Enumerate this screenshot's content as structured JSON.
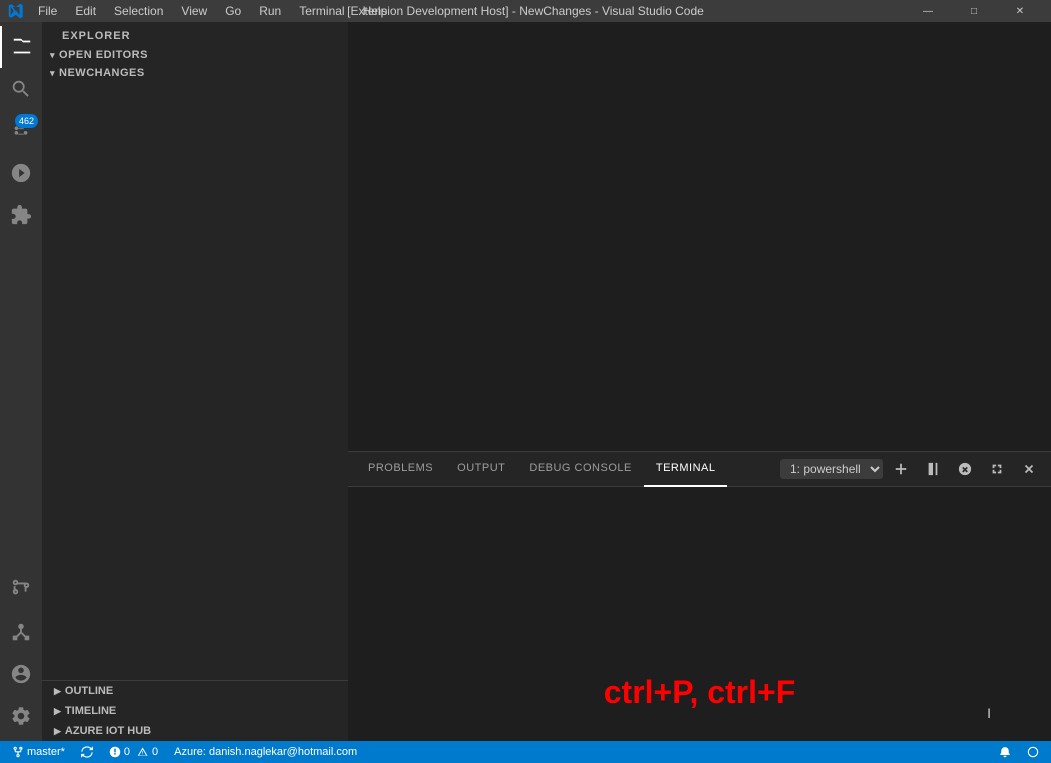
{
  "titleBar": {
    "title": "[Extension Development Host] - NewChanges - Visual Studio Code",
    "menu": [
      "File",
      "Edit",
      "Selection",
      "View",
      "Go",
      "Run",
      "Terminal",
      "Help"
    ]
  },
  "windowControls": {
    "minimize": "—",
    "maximize": "□",
    "close": "✕"
  },
  "activityBar": {
    "icons": [
      {
        "name": "explorer-icon",
        "label": "Explorer",
        "active": true
      },
      {
        "name": "search-icon",
        "label": "Search"
      },
      {
        "name": "source-control-icon",
        "label": "Source Control",
        "badge": "462"
      },
      {
        "name": "run-debug-icon",
        "label": "Run and Debug"
      },
      {
        "name": "extensions-icon",
        "label": "Extensions"
      },
      {
        "name": "git-pull-request-icon",
        "label": "Git Pull Requests"
      },
      {
        "name": "remote-explorer-icon",
        "label": "Remote Explorer"
      },
      {
        "name": "account-icon",
        "label": "Account"
      },
      {
        "name": "settings-icon",
        "label": "Settings"
      }
    ]
  },
  "sidebar": {
    "header": "Explorer",
    "sections": [
      {
        "label": "OPEN EDITORS",
        "collapsed": false
      },
      {
        "label": "NEWCHANGES",
        "collapsed": false
      }
    ],
    "bottomSections": [
      {
        "label": "OUTLINE"
      },
      {
        "label": "TIMELINE"
      },
      {
        "label": "AZURE IOT HUB"
      }
    ]
  },
  "panel": {
    "tabs": [
      "PROBLEMS",
      "OUTPUT",
      "DEBUG CONSOLE",
      "TERMINAL"
    ],
    "activeTab": "TERMINAL",
    "terminalSelector": "1: powershell",
    "terminalOptions": [
      "1: powershell"
    ],
    "shortcutText": "ctrl+P, ctrl+F"
  },
  "statusBar": {
    "branch": "master*",
    "syncIcon": "⟳",
    "errors": "0",
    "warnings": "0",
    "infoText": "Azure: danish.naglekar@hotmail.com",
    "cursorIcon": "I"
  }
}
